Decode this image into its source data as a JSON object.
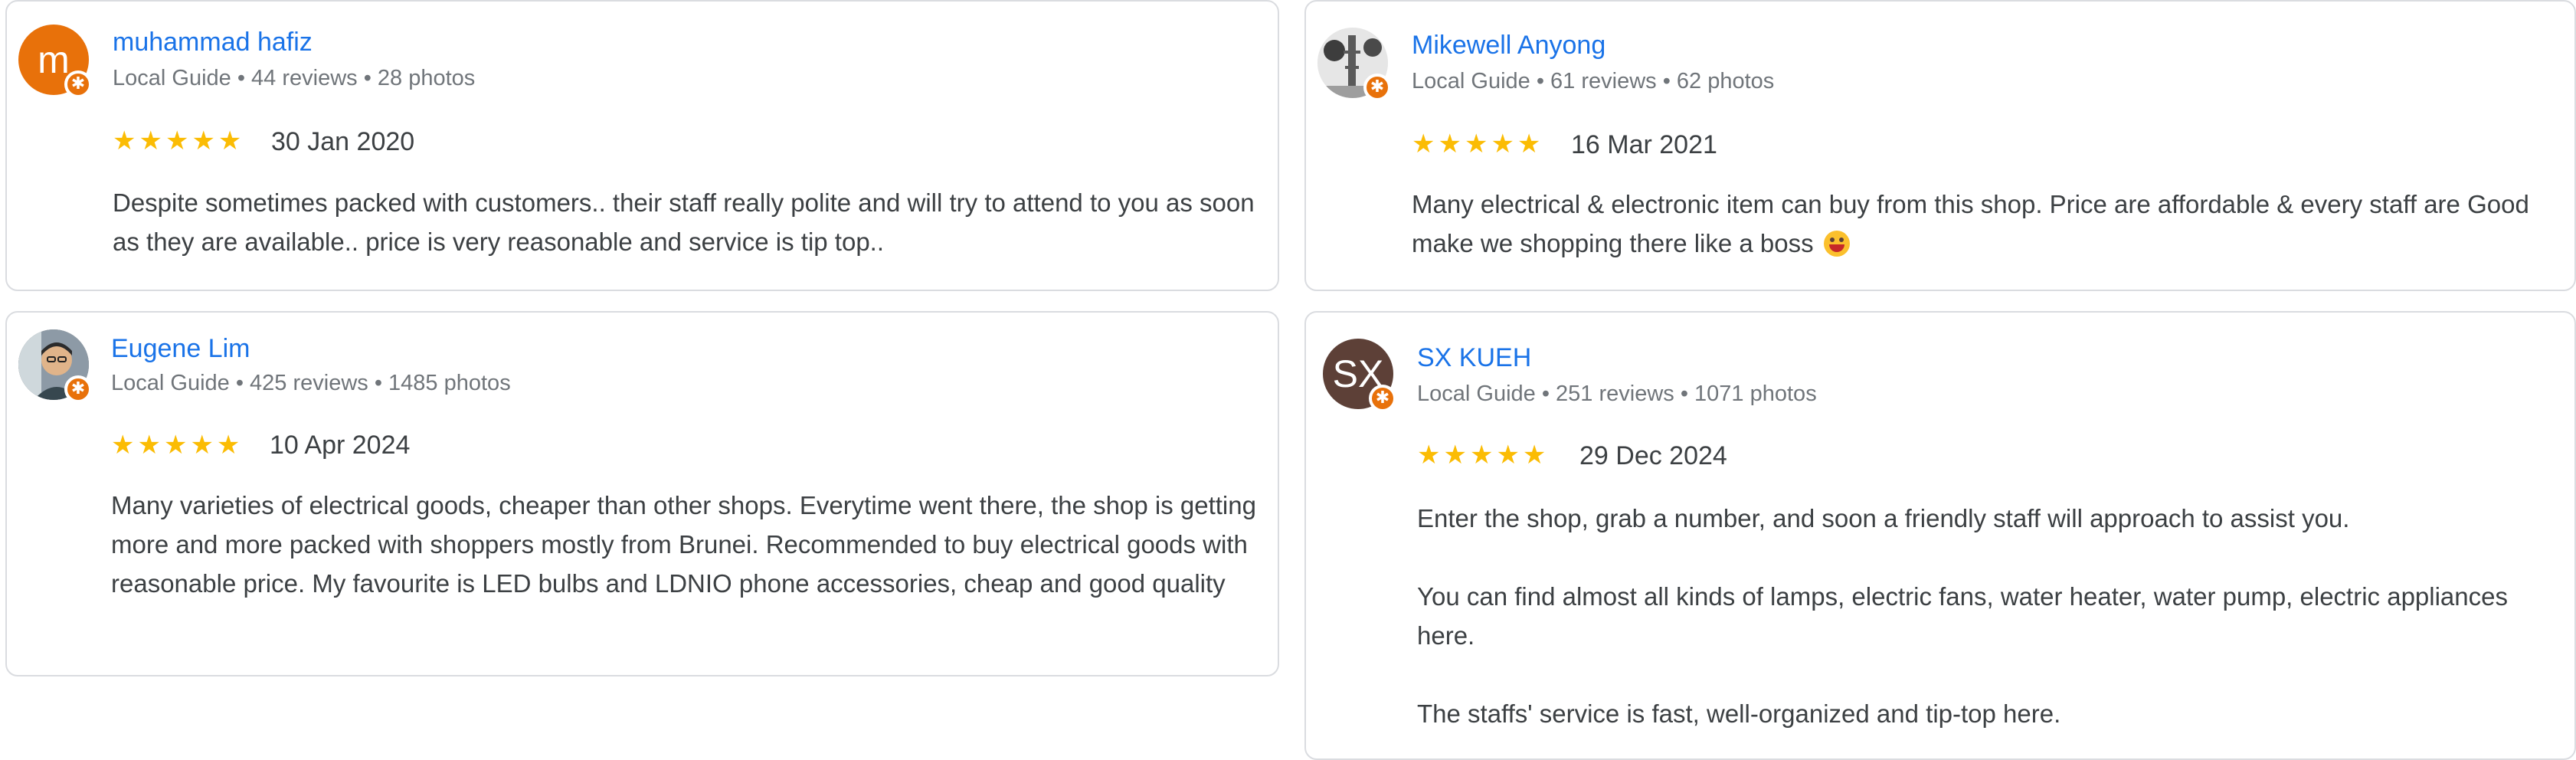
{
  "colors": {
    "name_link": "#1a73e8",
    "star": "#fbbc04",
    "local_guide_badge": "#e8710a",
    "card_border": "#dadce0"
  },
  "reviews": [
    {
      "author": "muhammad hafiz",
      "avatar_letter": "m",
      "avatar_color": "#e8710a",
      "meta": "Local Guide • 44 reviews • 28 photos",
      "stars": "★★★★★",
      "rating": 5,
      "date": "30 Jan 2020",
      "paragraphs": [
        "Despite sometimes packed with customers.. their staff really polite and will try to attend to you as soon as they are available.. price is very reasonable and service is tip top.."
      ]
    },
    {
      "author": "Eugene Lim",
      "avatar_letter": "",
      "avatar_color": "#6d6d6d",
      "meta": "Local Guide • 425 reviews • 1485 photos",
      "stars": "★★★★★",
      "rating": 5,
      "date": "10 Apr 2024",
      "paragraphs": [
        "Many varieties of electrical goods, cheaper than other shops. Everytime went there, the shop is getting more and more packed with shoppers mostly from Brunei. Recommended to buy electrical goods with reasonable price. My favourite is LED bulbs and LDNIO phone accessories, cheap and good quality"
      ]
    },
    {
      "author": "Mikewell Anyong",
      "avatar_letter": "",
      "avatar_color": "#9e9e9e",
      "meta": "Local Guide • 61 reviews • 62 photos",
      "stars": "★★★★★",
      "rating": 5,
      "date": "16 Mar 2021",
      "paragraphs": [
        "Many electrical & electronic item can buy from this shop. Price are affordable & every staff are Good make we shopping there like a boss"
      ]
    },
    {
      "author": "SX KUEH",
      "avatar_letter": "SX",
      "avatar_color": "#5d4037",
      "meta": "Local Guide • 251 reviews • 1071 photos",
      "stars": "★★★★★",
      "rating": 5,
      "date": "29 Dec 2024",
      "paragraphs": [
        "Enter the shop, grab a number, and soon a friendly staff will approach to assist you.",
        "You can find almost all kinds of lamps, electric fans, water heater, water pump, electric appliances here.",
        "The staffs' service is fast, well-organized and tip-top here."
      ]
    }
  ],
  "icons": {
    "local_guide_badge": "local-guide-star-icon",
    "emoji": "grinning-face-emoji-icon"
  }
}
